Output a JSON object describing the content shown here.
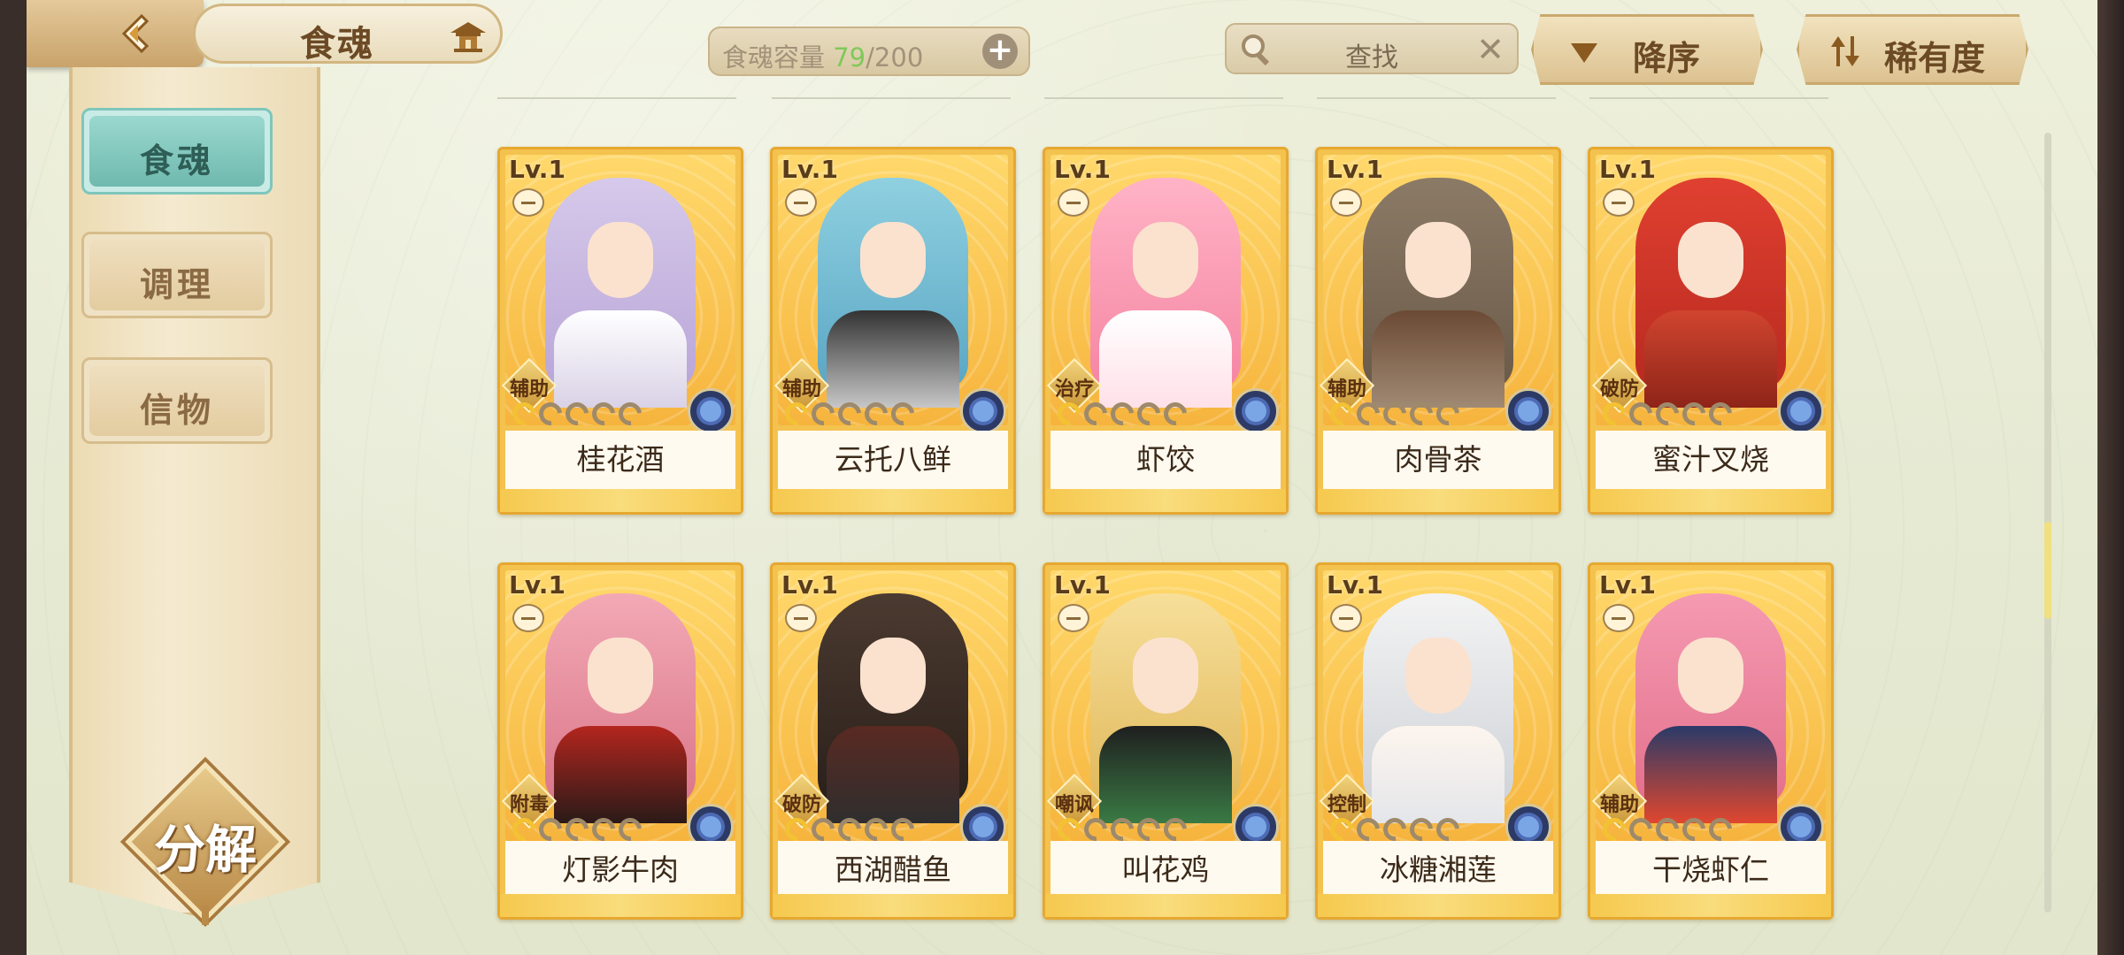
{
  "header": {
    "title": "食魂",
    "capacity_label": "食魂容量",
    "capacity_current": "79",
    "capacity_max": "/200",
    "search_label": "查找",
    "sort_order_label": "降序",
    "sort_by_label": "稀有度"
  },
  "sidebar": {
    "tabs": [
      {
        "label": "食魂",
        "active": true
      },
      {
        "label": "调理",
        "active": false
      },
      {
        "label": "信物",
        "active": false
      }
    ],
    "decompose_label": "分解"
  },
  "cards": [
    {
      "level": "Lv.1",
      "role": "辅助",
      "name": "桂花酒",
      "stars": 1
    },
    {
      "level": "Lv.1",
      "role": "辅助",
      "name": "云托八鲜",
      "stars": 1
    },
    {
      "level": "Lv.1",
      "role": "治疗",
      "name": "虾饺",
      "stars": 1
    },
    {
      "level": "Lv.1",
      "role": "辅助",
      "name": "肉骨茶",
      "stars": 1
    },
    {
      "level": "Lv.1",
      "role": "破防",
      "name": "蜜汁叉烧",
      "stars": 1
    },
    {
      "level": "Lv.1",
      "role": "附毒",
      "name": "灯影牛肉",
      "stars": 1
    },
    {
      "level": "Lv.1",
      "role": "破防",
      "name": "西湖醋鱼",
      "stars": 1
    },
    {
      "level": "Lv.1",
      "role": "嘲讽",
      "name": "叫花鸡",
      "stars": 1
    },
    {
      "level": "Lv.1",
      "role": "控制",
      "name": "冰糖湘莲",
      "stars": 1
    },
    {
      "level": "Lv.1",
      "role": "辅助",
      "name": "干烧虾仁",
      "stars": 1
    }
  ],
  "colors": {
    "card_gold": "#f4c24e",
    "active_tab": "#9ad8cf",
    "capacity_current": "#7fc95a"
  },
  "icons": {
    "back": "chevron-left-icon",
    "home": "pavilion-icon",
    "add": "plus-icon",
    "search": "magnifier-icon",
    "clear": "close-icon",
    "sort_order": "triangle-down-icon",
    "sort_by": "swap-icon",
    "element": "element-badge-icon",
    "star": "swirl-star-icon"
  }
}
